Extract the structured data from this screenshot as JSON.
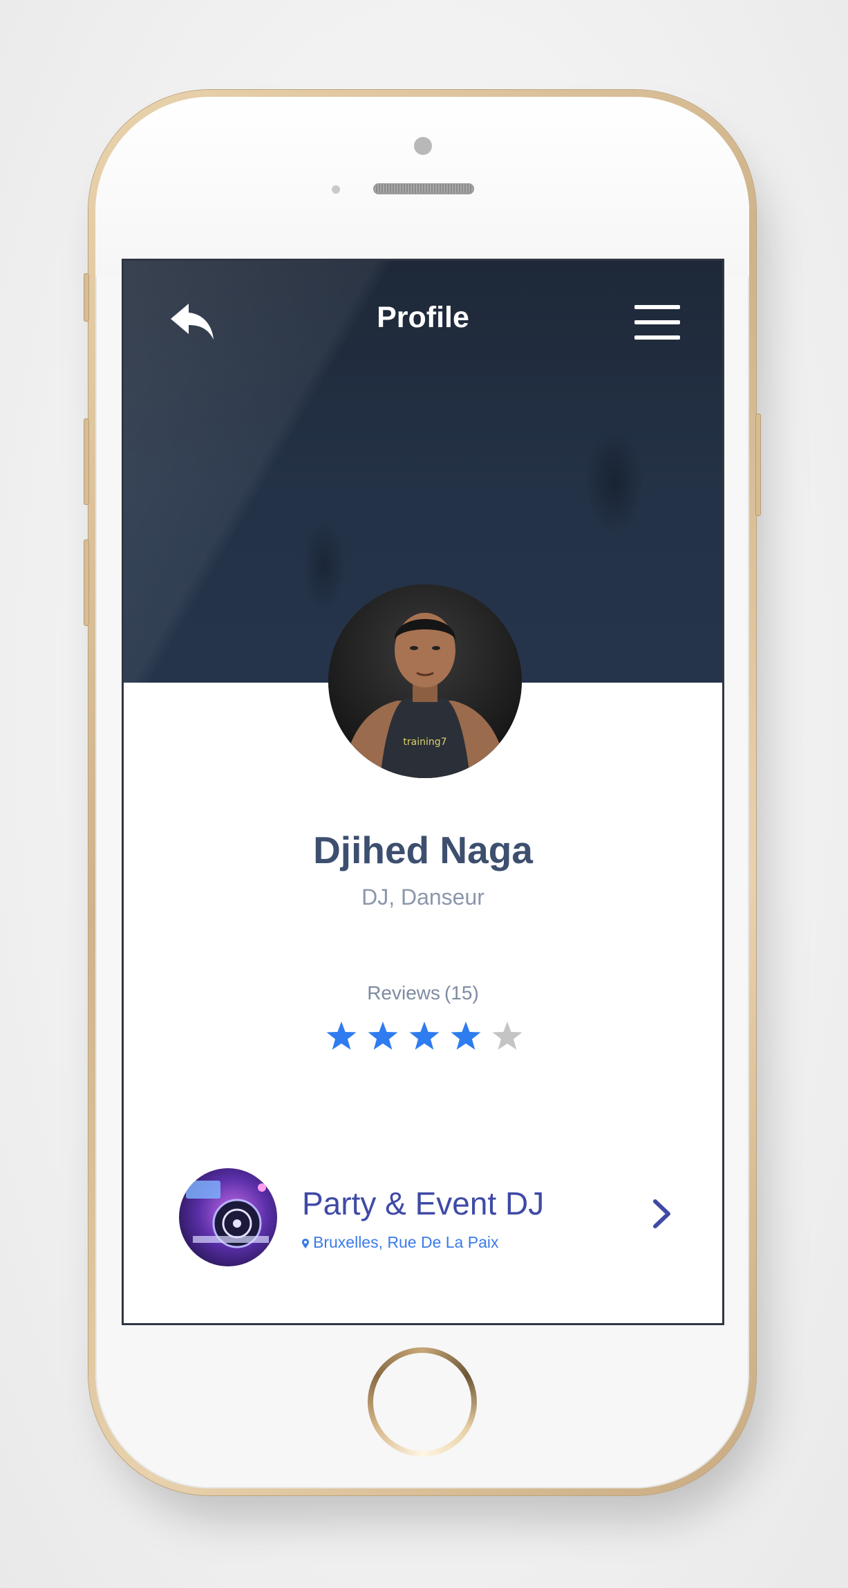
{
  "header": {
    "title": "Profile"
  },
  "profile": {
    "name": "Djihed Naga",
    "role": "DJ, Danseur",
    "reviews_label": "Reviews",
    "reviews_count": "(15)",
    "rating": 4,
    "rating_max": 5,
    "star_color": "#2f7cf0",
    "star_empty_color": "#c4c4c4"
  },
  "event": {
    "title": "Party & Event DJ",
    "location": "Bruxelles, Rue De La Paix"
  },
  "icons": {
    "back": "back-arrow-icon",
    "menu": "hamburger-menu-icon",
    "star": "star-icon",
    "pin": "location-pin-icon",
    "chevron": "chevron-right-icon"
  },
  "colors": {
    "header_bg": "#1f2a3b",
    "name": "#3d4f6e",
    "event_title": "#3f4aa6",
    "accent_blue": "#3a7be8",
    "phone_gold": "#d8bd92"
  }
}
